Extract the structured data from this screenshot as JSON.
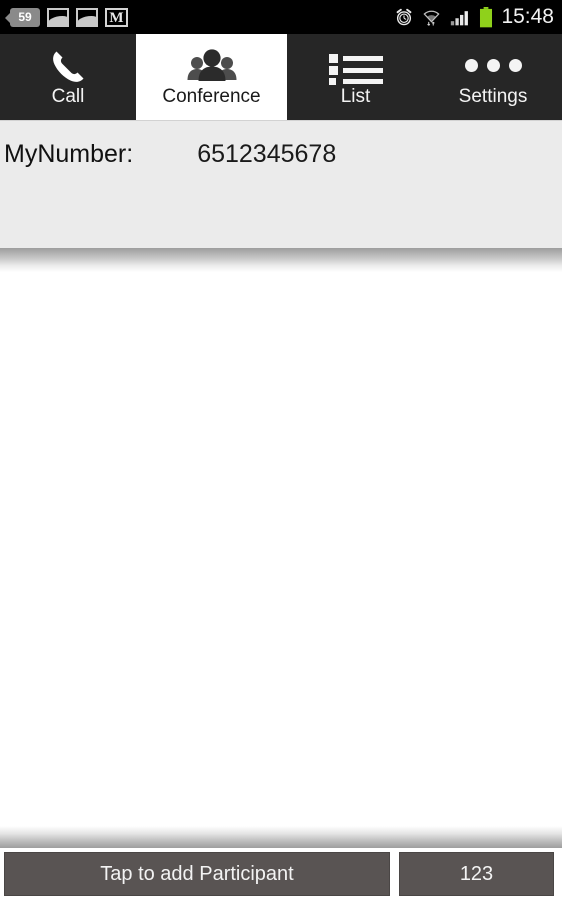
{
  "statusbar": {
    "download_badge": "59",
    "left_icons": [
      "download-badge",
      "photo-icon",
      "photo-icon",
      "gmail-icon"
    ],
    "right_icons": [
      "alarm-icon",
      "wifi-icon",
      "signal-icon",
      "battery-icon"
    ],
    "time": "15:48",
    "background_color": "#000000",
    "battery_color": "#8fd11b"
  },
  "tabs": [
    {
      "label": "Call",
      "icon": "phone-icon",
      "active": false
    },
    {
      "label": "Conference",
      "icon": "group-icon",
      "active": true
    },
    {
      "label": "List",
      "icon": "list-icon",
      "active": false
    },
    {
      "label": "Settings",
      "icon": "three-dots-icon",
      "active": false
    }
  ],
  "tabbar": {
    "background_color": "#262626",
    "active_background_color": "#ffffff"
  },
  "header": {
    "mynumber_label": "MyNumber:",
    "mynumber_value": "6512345678",
    "background_color": "#ebebeb",
    "actions": [
      {
        "name": "alarm-button",
        "icon": "alarm-clock-icon",
        "style": "dark"
      },
      {
        "name": "favorite-button",
        "icon": "star-icon",
        "style": "dark"
      },
      {
        "name": "call-button",
        "icon": "phone-icon",
        "style": "green",
        "color": "#18ad18"
      }
    ]
  },
  "participants": {
    "items": [],
    "empty": true
  },
  "bottombar": {
    "add_participant_label": "Tap to add Participant",
    "keypad_label": "123",
    "button_color": "#595453"
  }
}
